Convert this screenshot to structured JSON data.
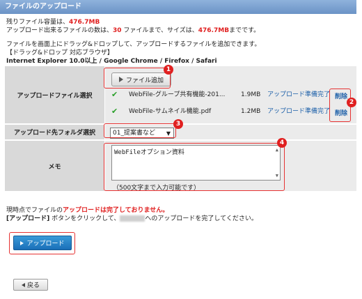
{
  "header": {
    "title": "ファイルのアップロード"
  },
  "info": {
    "capacity_prefix": "残りファイル容量は、",
    "capacity_value": "476.7MB",
    "count_prefix": "アップロード出来るファイルの数は、",
    "count_value": "30",
    "count_mid": " ファイルまで、サイズは、",
    "size_value": "476.7MB",
    "size_suffix": "までです。",
    "dragdrop_text": "ファイルを画面上にドラッグ&ドロップして、アップロードするファイルを追加できます。",
    "browsers_heading": "【ドラッグ&ドロップ 対応ブラウザ】",
    "browsers_list": "Internet Explorer 10.0以上 / Google Chrome / Firefox / Safari"
  },
  "form": {
    "file_label": "アップロードファイル選択",
    "add_file_button": "ファイル追加",
    "files": [
      {
        "name": "WebFile-グループ共有機能-201...",
        "size": "1.9MB",
        "status": "アップロード準備完了",
        "delete_label": "削除"
      },
      {
        "name": "WebFile-サムネイル機能.pdf",
        "size": "1.2MB",
        "status": "アップロード準備完了",
        "delete_label": "削除"
      }
    ],
    "folder_label": "アップロード先フォルダ選択",
    "folder_selected": "01_提案書など",
    "memo_label": "メモ",
    "memo_value": "WebFileオプション資料",
    "memo_note": "（500文字まで入力可能です）"
  },
  "callouts": [
    "1",
    "2",
    "3",
    "4"
  ],
  "notice": {
    "line1_prefix": "現時点でファイルの",
    "line1_red": "アップロードは完了しておりません。",
    "line2_prefix": "[アップロード]",
    "line2_mid": " ボタンをクリックして、",
    "line2_suffix": "へのアップロードを完了してください。"
  },
  "buttons": {
    "upload": "アップロード",
    "back": "戻る"
  },
  "colors": {
    "header_bg": "#7ba1d0",
    "accent_red": "#e02020",
    "link_blue": "#1a5ea8",
    "upload_blue": "#2a86c8"
  },
  "icons": {
    "add_file": "play-triangle-icon",
    "check": "check-icon",
    "upload": "play-triangle-icon",
    "back": "back-triangle-icon"
  }
}
